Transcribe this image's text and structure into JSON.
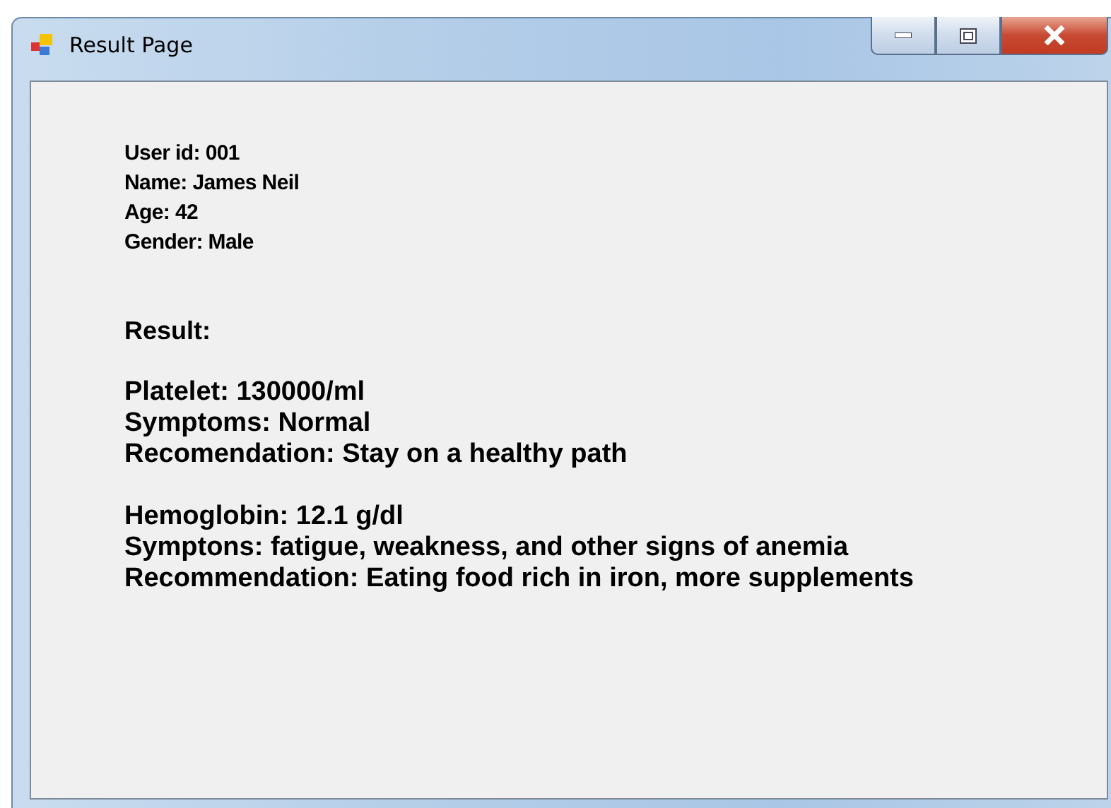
{
  "window": {
    "title": "Result Page"
  },
  "user_info": [
    "User id: 001",
    "Name: James Neil",
    "Age: 42",
    "Gender: Male"
  ],
  "result_heading": "Result:",
  "results": [
    {
      "lines": [
        "Platelet: 130000/ml",
        "Symptoms: Normal",
        "Recomendation: Stay on a healthy path"
      ]
    },
    {
      "lines": [
        "Hemoglobin: 12.1 g/dl",
        "Symptons: fatigue, weakness, and other signs of anemia",
        "Recommendation: Eating food rich in iron, more supplements"
      ]
    }
  ]
}
